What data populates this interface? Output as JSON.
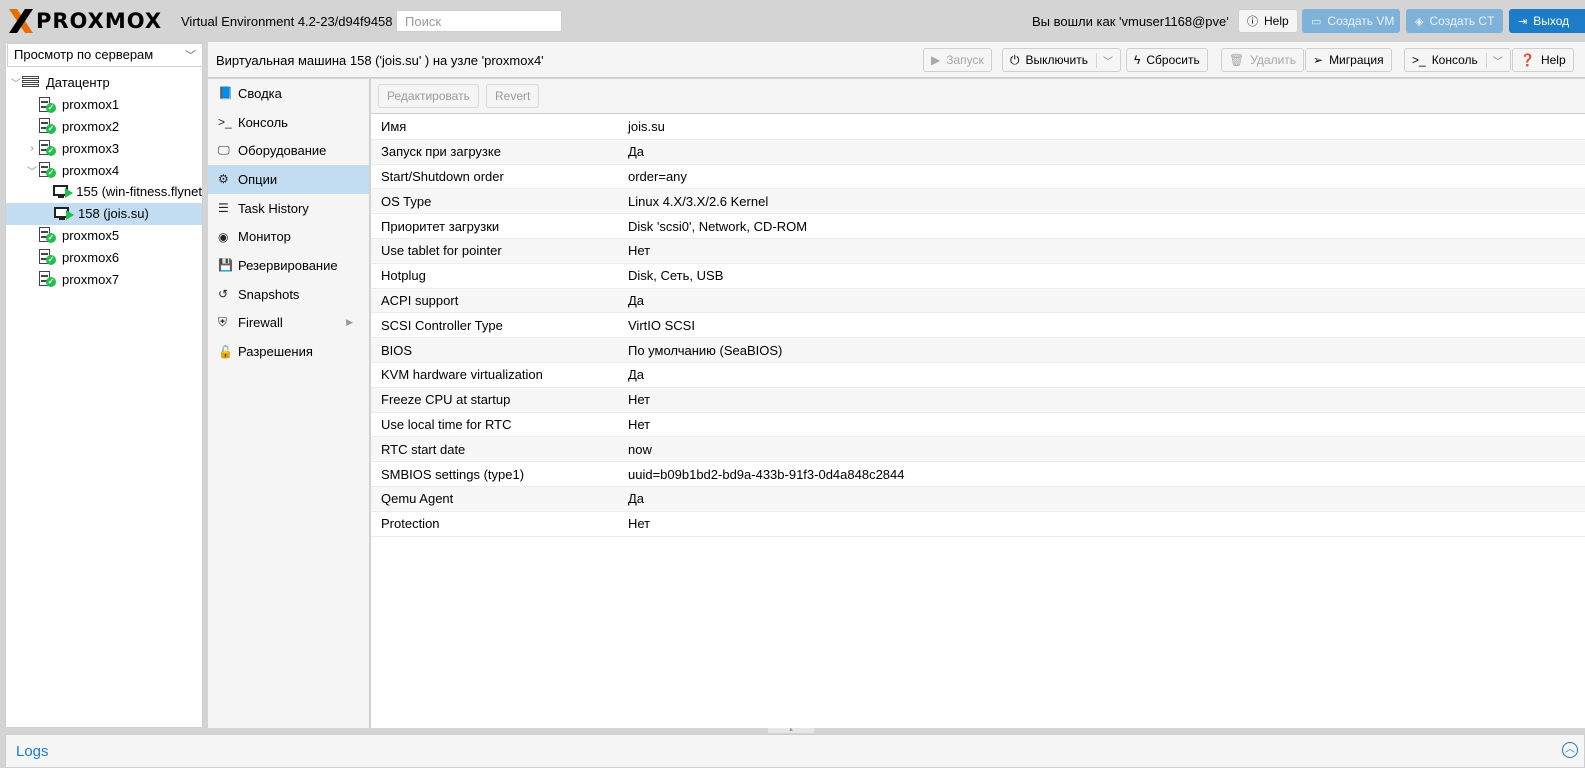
{
  "header": {
    "brand": "PROXMOX",
    "version": "Virtual Environment 4.2-23/d94f9458",
    "search_placeholder": "Поиск",
    "logged_in": "Вы вошли как 'vmuser1168@pve'",
    "help_label": "Help",
    "create_vm_label": "Создать VM",
    "create_ct_label": "Создать CT",
    "logout_label": "Выход"
  },
  "sidebar": {
    "view_select": "Просмотр по серверам",
    "tree": [
      {
        "label": "Датацентр",
        "type": "datacenter"
      },
      {
        "label": "proxmox1",
        "type": "node"
      },
      {
        "label": "proxmox2",
        "type": "node"
      },
      {
        "label": "proxmox3",
        "type": "node"
      },
      {
        "label": "proxmox4",
        "type": "node"
      },
      {
        "label": "155 (win-fitness.flynet",
        "type": "vm"
      },
      {
        "label": "158 (jois.su)",
        "type": "vm",
        "selected": true
      },
      {
        "label": "proxmox5",
        "type": "node"
      },
      {
        "label": "proxmox6",
        "type": "node"
      },
      {
        "label": "proxmox7",
        "type": "node"
      }
    ]
  },
  "content": {
    "title": "Виртуальная машина 158 ('jois.su' ) на узле 'proxmox4'",
    "toolbar": {
      "start": "Запуск",
      "shutdown": "Выключить",
      "reset": "Сбросить",
      "delete": "Удалить",
      "migrate": "Миграция",
      "console": "Консоль",
      "help": "Help"
    }
  },
  "nav": {
    "items": [
      {
        "label": "Сводка",
        "icon": "book-icon"
      },
      {
        "label": "Консоль",
        "icon": "terminal-icon"
      },
      {
        "label": "Оборудование",
        "icon": "monitor-icon"
      },
      {
        "label": "Опции",
        "icon": "gear-icon",
        "selected": true
      },
      {
        "label": "Task History",
        "icon": "list-icon"
      },
      {
        "label": "Монитор",
        "icon": "eye-icon"
      },
      {
        "label": "Резервирование",
        "icon": "floppy-icon"
      },
      {
        "label": "Snapshots",
        "icon": "history-icon"
      },
      {
        "label": "Firewall",
        "icon": "shield-icon"
      },
      {
        "label": "Разрешения",
        "icon": "unlock-icon"
      }
    ]
  },
  "grid": {
    "edit_label": "Редактировать",
    "revert_label": "Revert",
    "rows": [
      {
        "key": "Имя",
        "value": "jois.su"
      },
      {
        "key": "Запуск при загрузке",
        "value": "Да"
      },
      {
        "key": "Start/Shutdown order",
        "value": "order=any"
      },
      {
        "key": "OS Type",
        "value": "Linux 4.X/3.X/2.6 Kernel"
      },
      {
        "key": "Приоритет загрузки",
        "value": "Disk 'scsi0', Network, CD-ROM"
      },
      {
        "key": "Use tablet for pointer",
        "value": "Нет"
      },
      {
        "key": "Hotplug",
        "value": "Disk, Сеть, USB"
      },
      {
        "key": "ACPI support",
        "value": "Да"
      },
      {
        "key": "SCSI Controller Type",
        "value": "VirtIO SCSI"
      },
      {
        "key": "BIOS",
        "value": "По умолчанию (SeaBIOS)"
      },
      {
        "key": "KVM hardware virtualization",
        "value": "Да"
      },
      {
        "key": "Freeze CPU at startup",
        "value": "Нет"
      },
      {
        "key": "Use local time for RTC",
        "value": "Нет"
      },
      {
        "key": "RTC start date",
        "value": "now"
      },
      {
        "key": "SMBIOS settings (type1)",
        "value": "uuid=b09b1bd2-bd9a-433b-91f3-0d4a848c2844"
      },
      {
        "key": "Qemu Agent",
        "value": "Да"
      },
      {
        "key": "Protection",
        "value": "Нет"
      }
    ]
  },
  "logs": {
    "title": "Logs"
  },
  "colors": {
    "accent": "#1c7cc7",
    "selection": "#c2ddf2",
    "status_ok": "#21bf4b"
  }
}
